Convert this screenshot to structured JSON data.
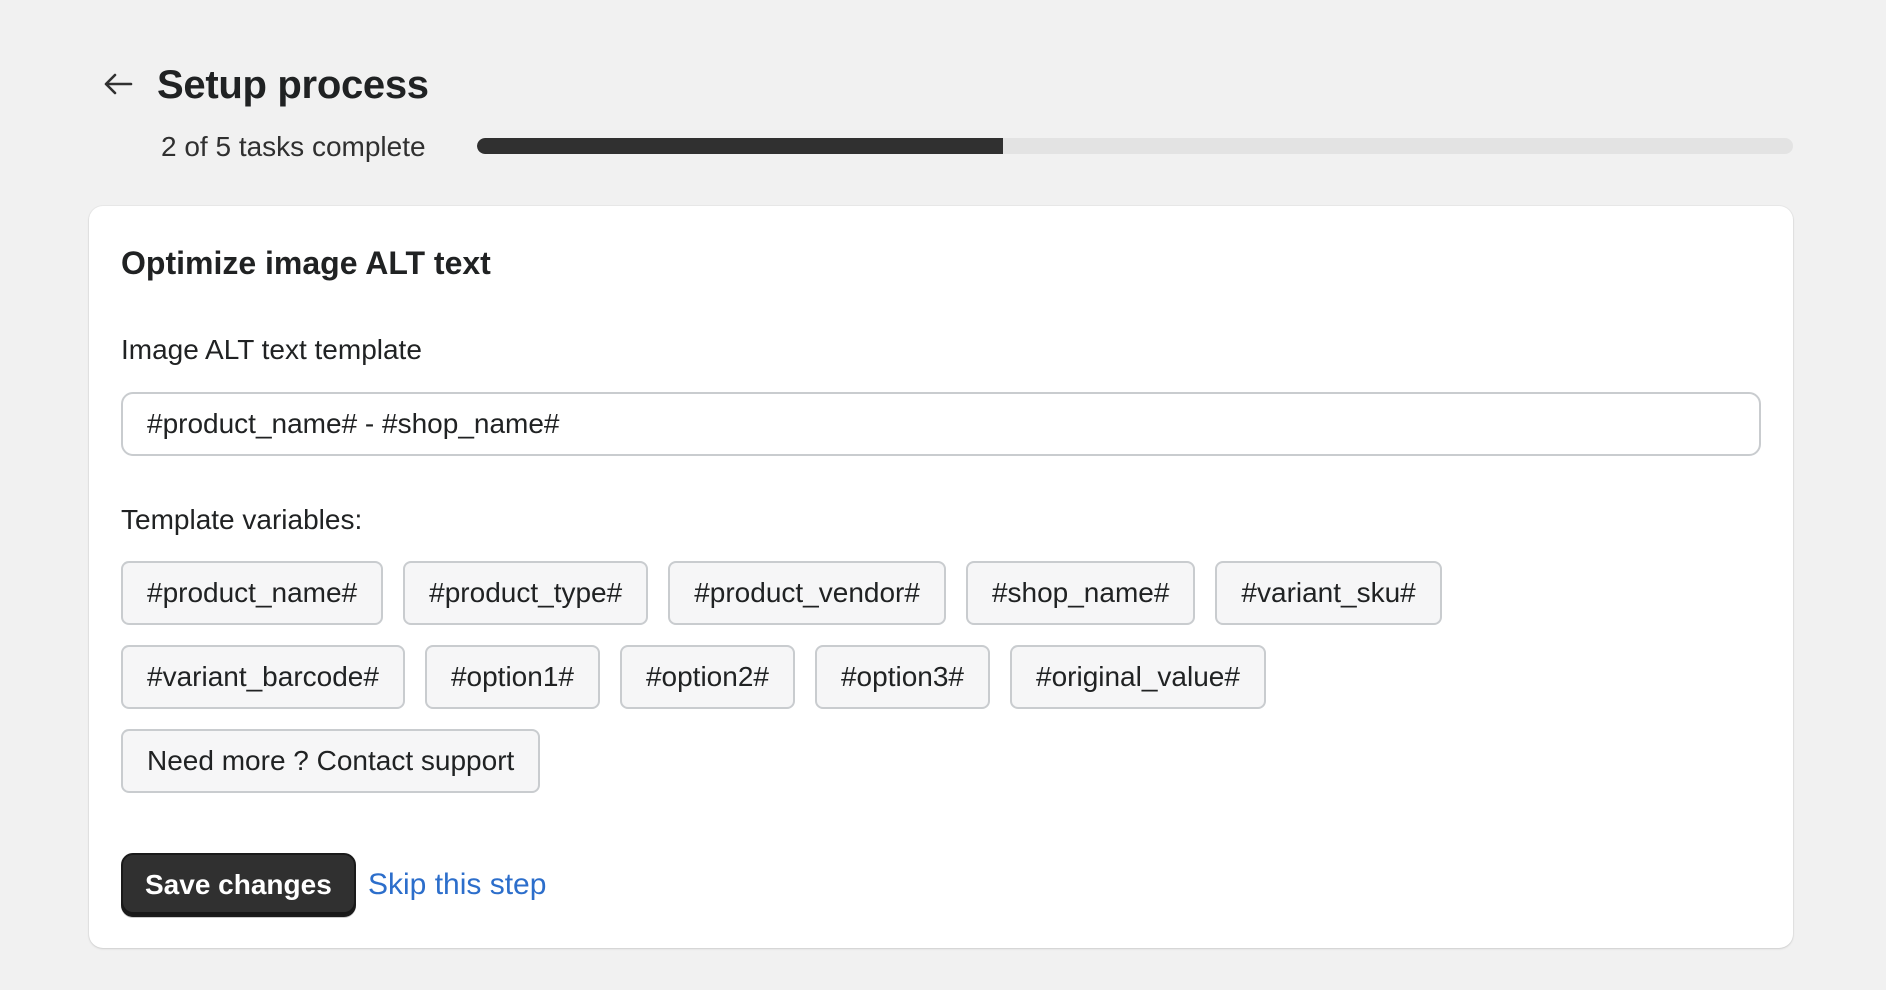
{
  "header": {
    "back_icon": "arrow-left-icon",
    "title": "Setup process",
    "progress_text": "2 of 5 tasks complete",
    "progress": {
      "completed": 2,
      "total": 5,
      "fraction": 0.4,
      "fill_color": "#303030",
      "track_color": "#e3e3e3"
    }
  },
  "card": {
    "title": "Optimize image ALT text",
    "field_label": "Image ALT text template",
    "field_value": "#product_name# - #shop_name#",
    "variables_label": "Template variables:",
    "variables_row1": [
      "#product_name#",
      "#product_type#",
      "#product_vendor#",
      "#shop_name#",
      "#variant_sku#"
    ],
    "variables_row2": [
      "#variant_barcode#",
      "#option1#",
      "#option2#",
      "#option3#",
      "#original_value#"
    ],
    "support_label": "Need more ? Contact support",
    "save_label": "Save changes",
    "skip_label": "Skip this step"
  },
  "colors": {
    "page_bg": "#f1f1f1",
    "card_bg": "#ffffff",
    "primary_button": "#303030",
    "link": "#2c6ecb"
  }
}
